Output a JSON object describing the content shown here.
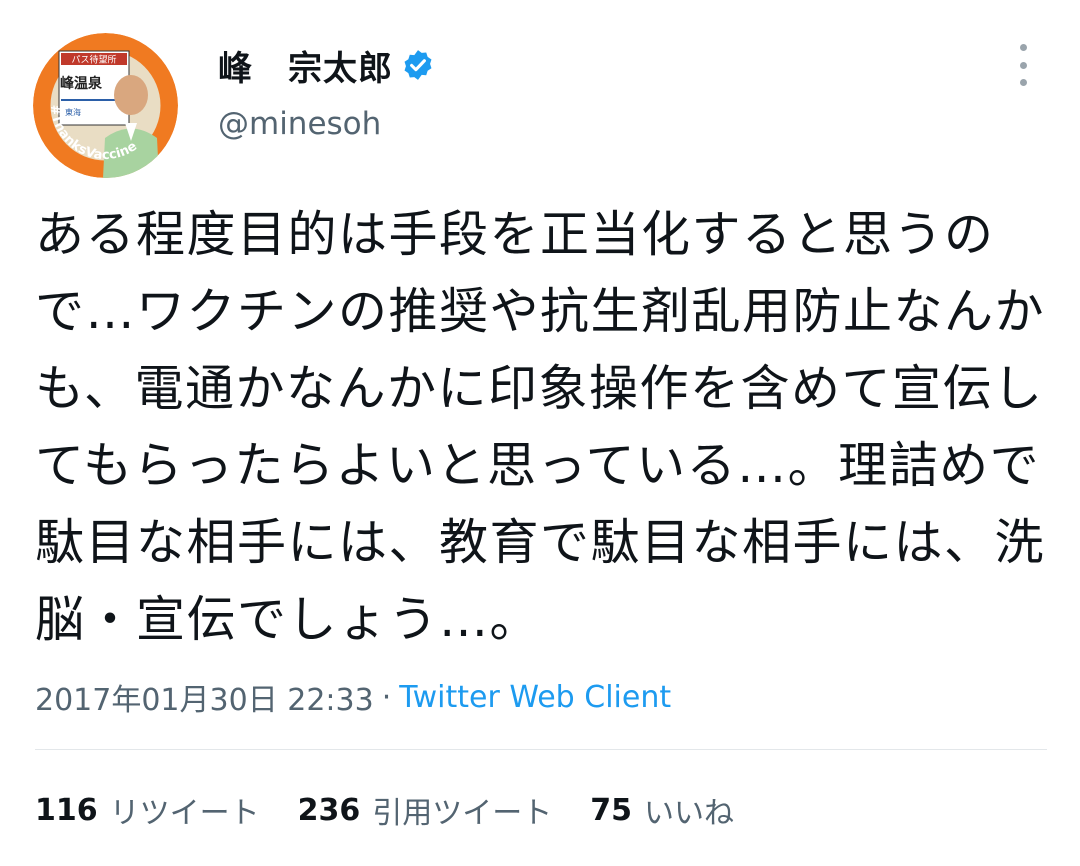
{
  "author": {
    "display_name": "峰　宗太郎",
    "handle": "@minesoh",
    "verified_icon": "verified-badge-icon",
    "avatar_sign_top": "パス待望所",
    "avatar_sign_main": "峰温泉",
    "avatar_sign_station": "東海",
    "avatar_ring_text": "#ThanksVaccine",
    "colors": {
      "ring": "#f07a21",
      "verified": "#1d9bf0"
    }
  },
  "tweet": {
    "text": "ある程度目的は手段を正当化すると思うので…ワクチンの推奨や抗生剤乱用防止なんかも、電通かなんかに印象操作を含めて宣伝してもらったらよいと思っている…。理詰めで駄目な相手には、教育で駄目な相手には、洗脳・宣伝でしょう…。",
    "timestamp": "2017年01月30日 22:33",
    "separator": "·",
    "client": "Twitter Web Client"
  },
  "stats": {
    "retweets": "116",
    "retweets_label": "リツイート",
    "quotes": "236",
    "quotes_label": "引用ツイート",
    "likes": "75",
    "likes_label": "いいね"
  },
  "icons": {
    "more": "more-options-icon"
  }
}
